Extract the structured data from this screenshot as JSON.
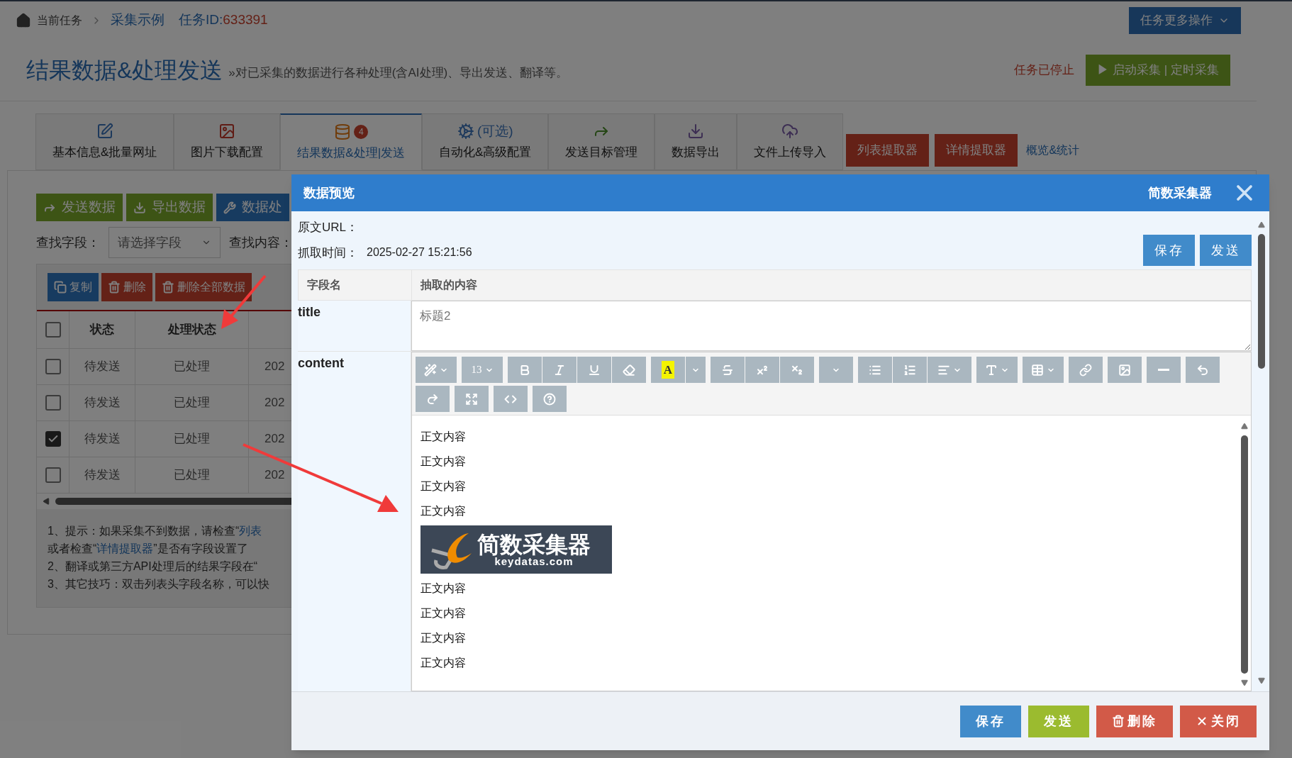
{
  "breadcrumb": {
    "home": "当前任务",
    "items": [
      {
        "label": "采集示例"
      }
    ],
    "task_id_label": "任务ID:",
    "task_id": "633391"
  },
  "more_button": "任务更多操作",
  "page": {
    "title": "结果数据&处理发送",
    "subtitle": "»对已采集的数据进行各种处理(含AI处理)、导出发送、翻译等。",
    "status": "任务已停止",
    "start_button": "▶ 启动采集 | 定时采集"
  },
  "tabs": [
    {
      "label": "基本信息&批量网址",
      "selected": false
    },
    {
      "label": "图片下载配置",
      "selected": false
    },
    {
      "label": "结果数据&处理|发送",
      "selected": true,
      "badge": "4"
    },
    {
      "label": "自动化&高级配置",
      "selected": false,
      "note": "(可选)"
    },
    {
      "label": "发送目标管理",
      "selected": false
    },
    {
      "label": "数据导出",
      "selected": false
    },
    {
      "label": "文件上传导入",
      "selected": false
    }
  ],
  "tab_buttons": [
    "列表提取器",
    "详情提取器"
  ],
  "overview_link": "概览&统计",
  "actions": [
    {
      "label": "发送数据",
      "kind": "send"
    },
    {
      "label": "导出数据",
      "kind": "export"
    },
    {
      "label": "数据处",
      "kind": "process"
    }
  ],
  "search": {
    "field_label": "查找字段：",
    "select_placeholder": "请选择字段",
    "content_label": "查找内容："
  },
  "table_actions": [
    {
      "label": "复制",
      "kind": "copy"
    },
    {
      "label": "删除",
      "kind": "delete"
    },
    {
      "label": "删除全部数据",
      "kind": "delete"
    }
  ],
  "table": {
    "header_checked": false,
    "columns": [
      "状态",
      "处理状态"
    ],
    "rows": [
      {
        "checked": false,
        "status": "待发送",
        "process": "已处理",
        "column_4": "202"
      },
      {
        "checked": false,
        "status": "待发送",
        "process": "已处理",
        "column_4": "202"
      },
      {
        "checked": true,
        "status": "待发送",
        "process": "已处理",
        "column_4": "202"
      },
      {
        "checked": false,
        "status": "待发送",
        "process": "已处理",
        "column_4": "202"
      }
    ]
  },
  "tips": [
    {
      "text": "1、提示：如果采集不到数据，请检查“",
      "link": "列表"
    },
    {
      "text": "或者检查“",
      "link": "详情提取器",
      "after": "”是否有字段设置了"
    },
    {
      "text": "2、翻译或第三方API处理后的结果字段在“"
    },
    {
      "text": "3、其它技巧：双击列表头字段名称，可以快"
    }
  ],
  "modal": {
    "title": "数据预览",
    "brand": "简数采集器",
    "url_label": "原文URL：",
    "time_label": "抓取时间：",
    "time": "2025-02-27 15:21:56",
    "top_buttons": [
      "保存",
      "发送"
    ],
    "columns": [
      "字段名",
      "抽取的内容"
    ],
    "fields": [
      {
        "name": "title",
        "kind": "text",
        "value": "标题2"
      },
      {
        "name": "content",
        "kind": "editor"
      }
    ],
    "editor": {
      "font_size": "13",
      "highlight": "A",
      "body": [
        {
          "kind": "paragraph",
          "text": "正文内容"
        },
        {
          "kind": "paragraph",
          "text": "正文内容"
        },
        {
          "kind": "paragraph",
          "text": "正文内容"
        },
        {
          "kind": "paragraph",
          "text": "正文内容"
        },
        {
          "kind": "logo",
          "title": "简数采集器",
          "url": "keydatas.com"
        },
        {
          "kind": "paragraph",
          "text": "正文内容"
        },
        {
          "kind": "paragraph",
          "text": "正文内容"
        },
        {
          "kind": "paragraph",
          "text": "正文内容"
        },
        {
          "kind": "paragraph",
          "text": "正文内容"
        }
      ]
    },
    "footer_buttons": [
      {
        "label": "保存",
        "kind": "save"
      },
      {
        "label": "发送",
        "kind": "send"
      },
      {
        "label": "删除",
        "kind": "delete"
      },
      {
        "label": "关闭",
        "kind": "close"
      }
    ]
  }
}
